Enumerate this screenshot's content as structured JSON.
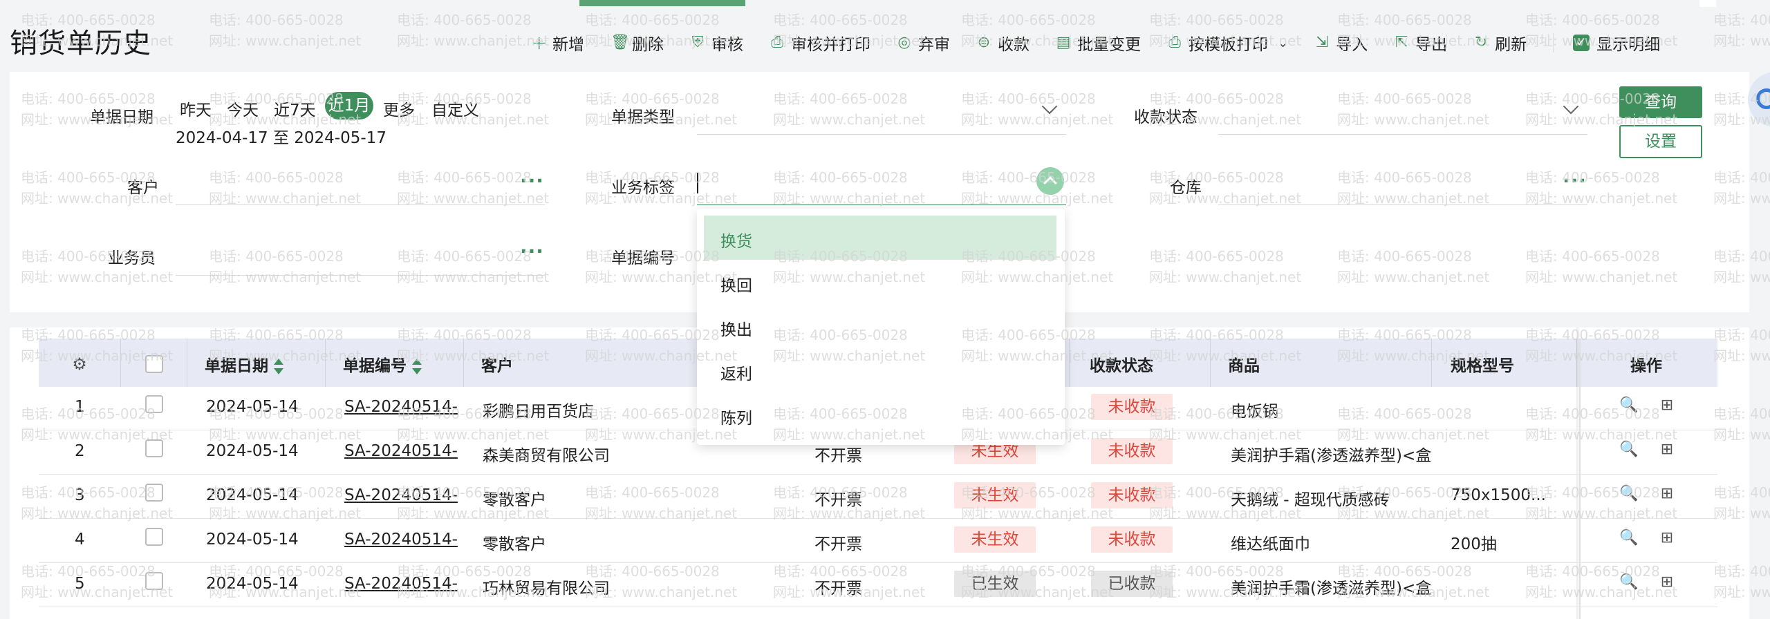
{
  "page": {
    "title": "销货单历史"
  },
  "watermark": {
    "line1": "电话: 400-665-0028",
    "line2": "网址: www.chanjet.net"
  },
  "toolbar": {
    "items": [
      {
        "label": "新增",
        "icon": "plus-icon"
      },
      {
        "label": "删除",
        "icon": "trash-icon"
      },
      {
        "label": "审核",
        "icon": "shield-check-icon"
      },
      {
        "label": "审核并打印",
        "icon": "print-check-icon"
      },
      {
        "label": "弃审",
        "icon": "undo-audit-icon"
      },
      {
        "label": "收款",
        "icon": "collect-icon"
      },
      {
        "label": "批量变更",
        "icon": "batch-edit-icon"
      },
      {
        "label": "按模板打印",
        "icon": "printer-icon"
      },
      {
        "label": "导入",
        "icon": "import-icon"
      },
      {
        "label": "导出",
        "icon": "export-icon"
      },
      {
        "label": "刷新",
        "icon": "refresh-icon"
      }
    ],
    "show_detail_label": "显示明细",
    "show_detail_checked": true
  },
  "filters": {
    "date_label": "单据日期",
    "date_options": [
      "昨天",
      "今天",
      "近7天",
      "近1月",
      "更多",
      "自定义"
    ],
    "date_selected": "近1月",
    "date_range": "2024-04-17 至 2024-05-17",
    "doc_type_label": "单据类型",
    "pay_status_label": "收款状态",
    "customer_label": "客户",
    "biz_tag_label": "业务标签",
    "warehouse_label": "仓库",
    "salesman_label": "业务员",
    "doc_no_label": "单据编号",
    "query_button": "查询",
    "settings_button": "设置"
  },
  "dropdown": {
    "options": [
      "换货",
      "换回",
      "换出",
      "返利",
      "陈列"
    ],
    "highlighted": "换货"
  },
  "table": {
    "headers": {
      "date": "单据日期",
      "doc_no": "单据编号",
      "customer": "客户",
      "pay_status": "收款状态",
      "product": "商品",
      "spec": "规格型号",
      "ops": "操作"
    },
    "rows": [
      {
        "no": "1",
        "date": "2024-05-14",
        "doc_no": "SA-20240514-",
        "customer": "彩鹏日用百货店",
        "invoice": "",
        "effect": "",
        "pay": "未收款",
        "product": "电饭锅",
        "spec": ""
      },
      {
        "no": "2",
        "date": "2024-05-14",
        "doc_no": "SA-20240514-",
        "customer": "森美商贸有限公司",
        "invoice": "不开票",
        "effect": "未生效",
        "pay": "未收款",
        "product": "美润护手霜(渗透滋养型)<盒",
        "spec": ""
      },
      {
        "no": "3",
        "date": "2024-05-14",
        "doc_no": "SA-20240514-",
        "customer": "零散客户",
        "invoice": "不开票",
        "effect": "未生效",
        "pay": "未收款",
        "product": "天鹅绒 - 超现代质感砖",
        "spec": "750x1500..."
      },
      {
        "no": "4",
        "date": "2024-05-14",
        "doc_no": "SA-20240514-",
        "customer": "零散客户",
        "invoice": "不开票",
        "effect": "未生效",
        "pay": "未收款",
        "product": "维达纸面巾",
        "spec": "200抽"
      },
      {
        "no": "5",
        "date": "2024-05-14",
        "doc_no": "SA-20240514-",
        "customer": "巧林贸易有限公司",
        "invoice": "不开票",
        "effect": "已生效",
        "pay": "已收款",
        "product": "美润护手霜(渗透滋养型)<盒",
        "spec": ""
      }
    ]
  }
}
